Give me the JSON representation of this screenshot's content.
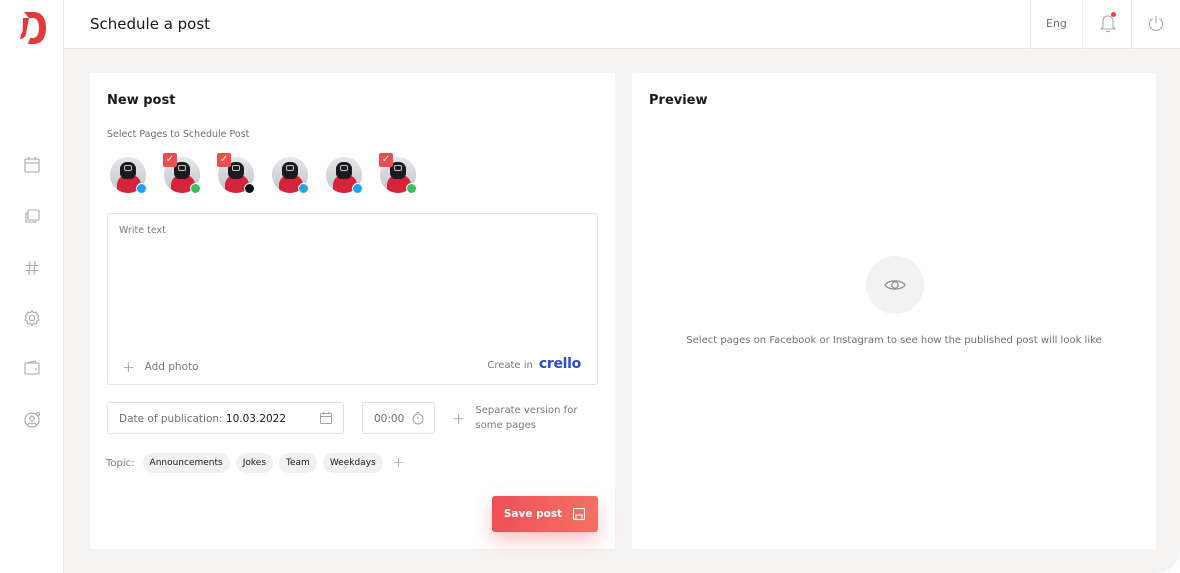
{
  "app": {
    "brand_color": "#f04f56"
  },
  "header": {
    "title": "Schedule a post",
    "language": "Eng"
  },
  "sidebar": {
    "items": [
      {
        "icon": "calendar-icon"
      },
      {
        "icon": "layers-icon"
      },
      {
        "icon": "hashtag-icon"
      },
      {
        "icon": "gear-icon"
      },
      {
        "icon": "wallet-icon"
      },
      {
        "icon": "user-settings-icon"
      }
    ]
  },
  "new_post": {
    "title": "New post",
    "pages_label": "Select Pages to Schedule Post",
    "pages": [
      {
        "network": "twitter",
        "selected": false,
        "badge_color": "#1da1f2"
      },
      {
        "network": "whatsapp",
        "selected": true,
        "badge_color": "#3ac05a"
      },
      {
        "network": "tiktok",
        "selected": true,
        "badge_color": "#111111"
      },
      {
        "network": "telegram",
        "selected": false,
        "badge_color": "#2aa3df"
      },
      {
        "network": "twitter",
        "selected": false,
        "badge_color": "#1da1f2"
      },
      {
        "network": "whatsapp",
        "selected": true,
        "badge_color": "#3ac05a"
      }
    ],
    "text_placeholder": "Write text",
    "add_photo": "Add photo",
    "create_in": "Create in",
    "crello": "crello",
    "date_label": "Date of publication:",
    "date_value": "10.03.2022",
    "time_value": "00:00",
    "separate_version": "Separate version for some pages",
    "topic_label": "Topic:",
    "topics": [
      "Announcements",
      "Jokes",
      "Team",
      "Weekdays"
    ],
    "save_label": "Save post"
  },
  "preview": {
    "title": "Preview",
    "hint": "Select pages on Facebook or Instagram to see how the published post will look like"
  }
}
